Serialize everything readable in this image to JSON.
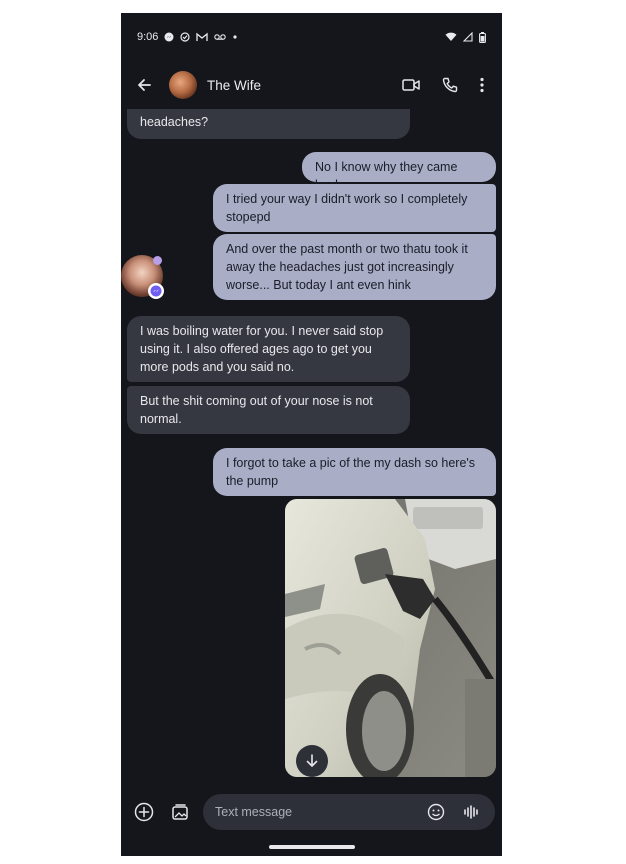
{
  "status_bar": {
    "time": "9:06",
    "left_icons": [
      "messenger-icon",
      "check-circle-icon",
      "gmail-icon",
      "voicemail-icon",
      "dot-icon"
    ],
    "right_icons": [
      "wifi-icon",
      "signal-icon",
      "battery-icon"
    ]
  },
  "header": {
    "contact_name": "The Wife",
    "actions": [
      "video-call-icon",
      "phone-icon",
      "more-vert-icon"
    ]
  },
  "messages": [
    {
      "direction": "in",
      "text": "headaches?"
    },
    {
      "direction": "out",
      "text": "No I know why they came back"
    },
    {
      "direction": "out",
      "text": "I tried your way I didn't work so I completely stopepd"
    },
    {
      "direction": "out",
      "text": "And over the past month or two thatu took it away the headaches just got increasingly worse... But today I ant even hink"
    },
    {
      "direction": "in",
      "text": "I was boiling water for you. I never said stop using it. I also offered ages ago to get you more pods and you said no."
    },
    {
      "direction": "in",
      "text": "But the shit coming out of your nose is not normal."
    },
    {
      "direction": "out",
      "text": "I forgot to take a pic of the my dash so here's the pump"
    }
  ],
  "composer": {
    "placeholder": "Text message",
    "left_icons": [
      "add-icon",
      "gallery-icon"
    ],
    "right_icons": [
      "emoji-icon",
      "voice-icon"
    ]
  },
  "colors": {
    "background": "#14161b",
    "incoming_bubble": "#353840",
    "outgoing_bubble": "#a9adc6"
  }
}
